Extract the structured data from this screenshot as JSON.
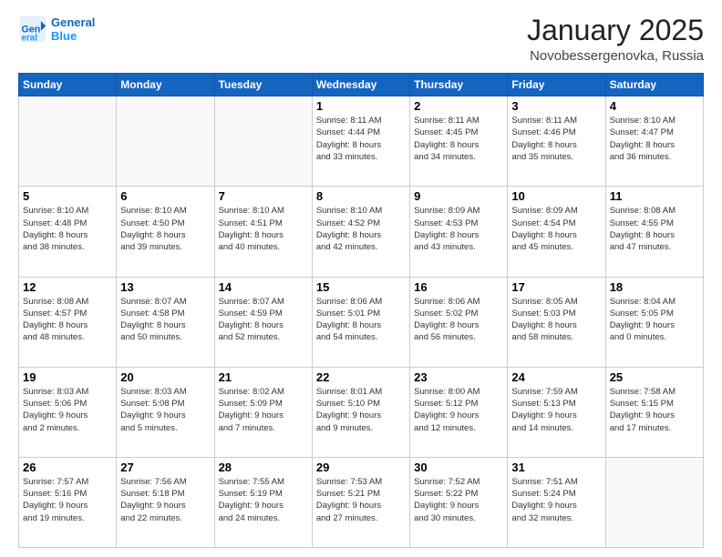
{
  "logo": {
    "line1": "General",
    "line2": "Blue"
  },
  "title": "January 2025",
  "location": "Novobessergenovka, Russia",
  "days_of_week": [
    "Sunday",
    "Monday",
    "Tuesday",
    "Wednesday",
    "Thursday",
    "Friday",
    "Saturday"
  ],
  "weeks": [
    [
      {
        "day": "",
        "info": ""
      },
      {
        "day": "",
        "info": ""
      },
      {
        "day": "",
        "info": ""
      },
      {
        "day": "1",
        "info": "Sunrise: 8:11 AM\nSunset: 4:44 PM\nDaylight: 8 hours\nand 33 minutes."
      },
      {
        "day": "2",
        "info": "Sunrise: 8:11 AM\nSunset: 4:45 PM\nDaylight: 8 hours\nand 34 minutes."
      },
      {
        "day": "3",
        "info": "Sunrise: 8:11 AM\nSunset: 4:46 PM\nDaylight: 8 hours\nand 35 minutes."
      },
      {
        "day": "4",
        "info": "Sunrise: 8:10 AM\nSunset: 4:47 PM\nDaylight: 8 hours\nand 36 minutes."
      }
    ],
    [
      {
        "day": "5",
        "info": "Sunrise: 8:10 AM\nSunset: 4:48 PM\nDaylight: 8 hours\nand 38 minutes."
      },
      {
        "day": "6",
        "info": "Sunrise: 8:10 AM\nSunset: 4:50 PM\nDaylight: 8 hours\nand 39 minutes."
      },
      {
        "day": "7",
        "info": "Sunrise: 8:10 AM\nSunset: 4:51 PM\nDaylight: 8 hours\nand 40 minutes."
      },
      {
        "day": "8",
        "info": "Sunrise: 8:10 AM\nSunset: 4:52 PM\nDaylight: 8 hours\nand 42 minutes."
      },
      {
        "day": "9",
        "info": "Sunrise: 8:09 AM\nSunset: 4:53 PM\nDaylight: 8 hours\nand 43 minutes."
      },
      {
        "day": "10",
        "info": "Sunrise: 8:09 AM\nSunset: 4:54 PM\nDaylight: 8 hours\nand 45 minutes."
      },
      {
        "day": "11",
        "info": "Sunrise: 8:08 AM\nSunset: 4:55 PM\nDaylight: 8 hours\nand 47 minutes."
      }
    ],
    [
      {
        "day": "12",
        "info": "Sunrise: 8:08 AM\nSunset: 4:57 PM\nDaylight: 8 hours\nand 48 minutes."
      },
      {
        "day": "13",
        "info": "Sunrise: 8:07 AM\nSunset: 4:58 PM\nDaylight: 8 hours\nand 50 minutes."
      },
      {
        "day": "14",
        "info": "Sunrise: 8:07 AM\nSunset: 4:59 PM\nDaylight: 8 hours\nand 52 minutes."
      },
      {
        "day": "15",
        "info": "Sunrise: 8:06 AM\nSunset: 5:01 PM\nDaylight: 8 hours\nand 54 minutes."
      },
      {
        "day": "16",
        "info": "Sunrise: 8:06 AM\nSunset: 5:02 PM\nDaylight: 8 hours\nand 56 minutes."
      },
      {
        "day": "17",
        "info": "Sunrise: 8:05 AM\nSunset: 5:03 PM\nDaylight: 8 hours\nand 58 minutes."
      },
      {
        "day": "18",
        "info": "Sunrise: 8:04 AM\nSunset: 5:05 PM\nDaylight: 9 hours\nand 0 minutes."
      }
    ],
    [
      {
        "day": "19",
        "info": "Sunrise: 8:03 AM\nSunset: 5:06 PM\nDaylight: 9 hours\nand 2 minutes."
      },
      {
        "day": "20",
        "info": "Sunrise: 8:03 AM\nSunset: 5:08 PM\nDaylight: 9 hours\nand 5 minutes."
      },
      {
        "day": "21",
        "info": "Sunrise: 8:02 AM\nSunset: 5:09 PM\nDaylight: 9 hours\nand 7 minutes."
      },
      {
        "day": "22",
        "info": "Sunrise: 8:01 AM\nSunset: 5:10 PM\nDaylight: 9 hours\nand 9 minutes."
      },
      {
        "day": "23",
        "info": "Sunrise: 8:00 AM\nSunset: 5:12 PM\nDaylight: 9 hours\nand 12 minutes."
      },
      {
        "day": "24",
        "info": "Sunrise: 7:59 AM\nSunset: 5:13 PM\nDaylight: 9 hours\nand 14 minutes."
      },
      {
        "day": "25",
        "info": "Sunrise: 7:58 AM\nSunset: 5:15 PM\nDaylight: 9 hours\nand 17 minutes."
      }
    ],
    [
      {
        "day": "26",
        "info": "Sunrise: 7:57 AM\nSunset: 5:16 PM\nDaylight: 9 hours\nand 19 minutes."
      },
      {
        "day": "27",
        "info": "Sunrise: 7:56 AM\nSunset: 5:18 PM\nDaylight: 9 hours\nand 22 minutes."
      },
      {
        "day": "28",
        "info": "Sunrise: 7:55 AM\nSunset: 5:19 PM\nDaylight: 9 hours\nand 24 minutes."
      },
      {
        "day": "29",
        "info": "Sunrise: 7:53 AM\nSunset: 5:21 PM\nDaylight: 9 hours\nand 27 minutes."
      },
      {
        "day": "30",
        "info": "Sunrise: 7:52 AM\nSunset: 5:22 PM\nDaylight: 9 hours\nand 30 minutes."
      },
      {
        "day": "31",
        "info": "Sunrise: 7:51 AM\nSunset: 5:24 PM\nDaylight: 9 hours\nand 32 minutes."
      },
      {
        "day": "",
        "info": ""
      }
    ]
  ]
}
